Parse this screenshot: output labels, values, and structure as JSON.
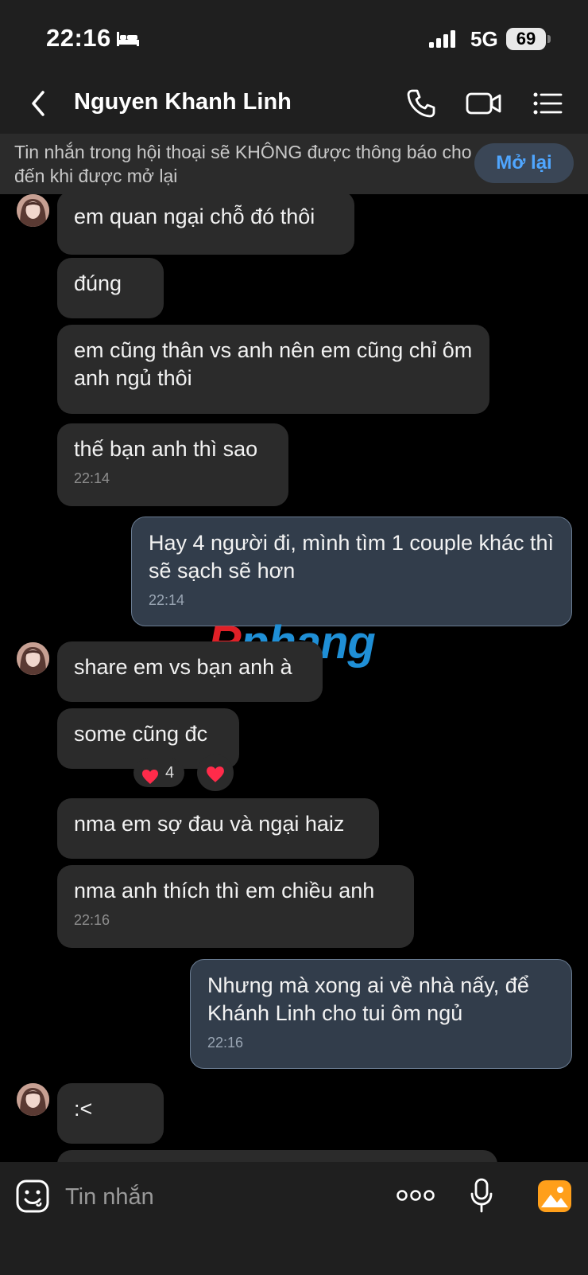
{
  "status_bar": {
    "time": "22:16",
    "network": "5G",
    "battery": "69"
  },
  "header": {
    "contact_name": "Nguyen Khanh Linh"
  },
  "mute_banner": {
    "text": "Tin nhắn trong hội thoại sẽ KHÔNG được thông báo cho đến khi được mở lại",
    "button_label": "Mở lại"
  },
  "watermark": {
    "first": "R",
    "rest": "phang"
  },
  "messages": [
    {
      "text": "em quan ngại chỗ đó thôi"
    },
    {
      "text": "đúng"
    },
    {
      "text": "em cũng thân vs anh nên em cũng chỉ ôm anh ngủ thôi"
    },
    {
      "text": "thế bạn anh thì sao",
      "time": "22:14"
    },
    {
      "text": "Hay 4 người đi, mình tìm 1 couple khác thì sẽ sạch sẽ hơn",
      "time": "22:14"
    },
    {
      "text": "share em vs bạn anh à"
    },
    {
      "text": "some cũng đc",
      "reaction_count": "4"
    },
    {
      "text": "nma em sợ đau và ngại haiz"
    },
    {
      "text": "nma anh thích thì em chiều anh",
      "time": "22:16"
    },
    {
      "text": "Nhưng mà xong ai về nhà nấy, để Khánh Linh cho tui ôm ngủ",
      "time": "22:16"
    },
    {
      "text": ":<"
    }
  ],
  "composer": {
    "placeholder": "Tin nhắn"
  },
  "colors": {
    "incoming_bubble": "#2b2b2b",
    "outgoing_bubble": "#323d4b",
    "accent": "#4fa6ff",
    "gallery_icon": "#ff9f1a"
  }
}
